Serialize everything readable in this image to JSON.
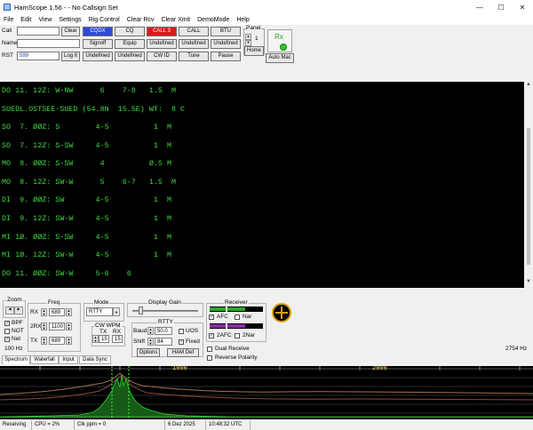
{
  "window": {
    "title": "HamScope 1.56 - - No Callsign Set",
    "minimize": "—",
    "maximize": "☐",
    "close": "✕"
  },
  "menu": [
    "File",
    "Edit",
    "View",
    "Settings",
    "Rig Control",
    "Clear Rcv",
    "Clear Xmit",
    "DemoMode",
    "Help"
  ],
  "toolbar": {
    "call_label": "Call",
    "name_label": "Name",
    "rst_label": "RST",
    "call_value": "",
    "name_value": "",
    "rst_value": "599",
    "clear": "Clear",
    "log_it": "Log It",
    "buttons_row1": [
      "CQDX",
      "CQ",
      "CALL 3",
      "CALL",
      "BTU"
    ],
    "buttons_row2": [
      "Signoff",
      "Equip",
      "Undefined",
      "Undefined",
      "Undefined"
    ],
    "buttons_row3": [
      "Undefined",
      "Undefined",
      "CW ID",
      "Tune",
      "Pause"
    ],
    "panel_label": "Panel",
    "panel_value": "1",
    "home": "Home",
    "rx_label": "Rx",
    "auto_mac": "Auto Mac"
  },
  "terminal": {
    "lines": [
      "DO 11. 12Z: W-NW      6    7-8   1.5  M",
      "SUEDL.OSTSEE-SUED (54.8N  15.5E) WT:  8 C",
      "SO  7. ØØZ: S        4-5          1  M",
      "SO  7. 12Z: S-SW     4-5          1  M",
      "MO  8. ØØZ: S-SW      4          Ø.5 M",
      "MO  8. 12Z: SW-W      5    6-7   1.5  M",
      "DI  9. ØØZ: SW       4-5          1  M",
      "DI  9. 12Z: SW-W     4-5          1  M",
      "MI 1Ø. ØØZ: S-SW     4-5          1  M",
      "MI 1Ø. 12Z: SW-W     4-5          1  M",
      "DO 11. ØØZ: SW-W     5-6    6"
    ]
  },
  "zoom": {
    "label": "Zoom",
    "opts": [
      "BPF",
      "NOT",
      "Net"
    ],
    "checked": [
      true,
      false,
      true
    ],
    "hz": "100 Hz"
  },
  "freq": {
    "label": "Freq",
    "rx_label": "RX",
    "rx": "689",
    "rx2_label": "2RX",
    "rx2": "1100",
    "tx_label": "TX",
    "tx": "689"
  },
  "mode": {
    "label": "Mode",
    "value": "RTTY",
    "cw_wpm": "CW WPM",
    "tx_label": "TX",
    "rx_label": "RX",
    "tx": "15",
    "rx": "15"
  },
  "display_gain": {
    "label": "Display Gain"
  },
  "rtty": {
    "label": "RTTY",
    "baud_label": "Baud",
    "baud": "50.0",
    "shift_label": "Shift",
    "shift": "84",
    "uos": "UOS",
    "fixed": "Fixed",
    "options": "Options",
    "ham_def": "HAM Def"
  },
  "receiver": {
    "label": "Receiver",
    "afc": "AFC",
    "nar": "Nar",
    "afc2": "2AFC",
    "nar2": "2Nar",
    "afc_checked": true,
    "afc2_checked": true
  },
  "extra": {
    "dual_receive": "Dual Receive",
    "reverse_polarity": "Reverse Polarity",
    "hz_readout": "2754 Hz"
  },
  "tabs": [
    "Spectrum",
    "Waterfall",
    "Input",
    "Data Sync"
  ],
  "waterfall": {
    "tick_1000": "1000",
    "tick_2000": "2000"
  },
  "status": {
    "state": "Receiving",
    "cpu": "CPU = 2%",
    "clk": "Clk ppm = 0",
    "date": "6 Dez 2025",
    "time": "10:48:32 UTC"
  },
  "colors": {
    "terminal_text": "#3fdc3f",
    "cqdx": "#2f4ad8",
    "call3": "#e01818"
  }
}
